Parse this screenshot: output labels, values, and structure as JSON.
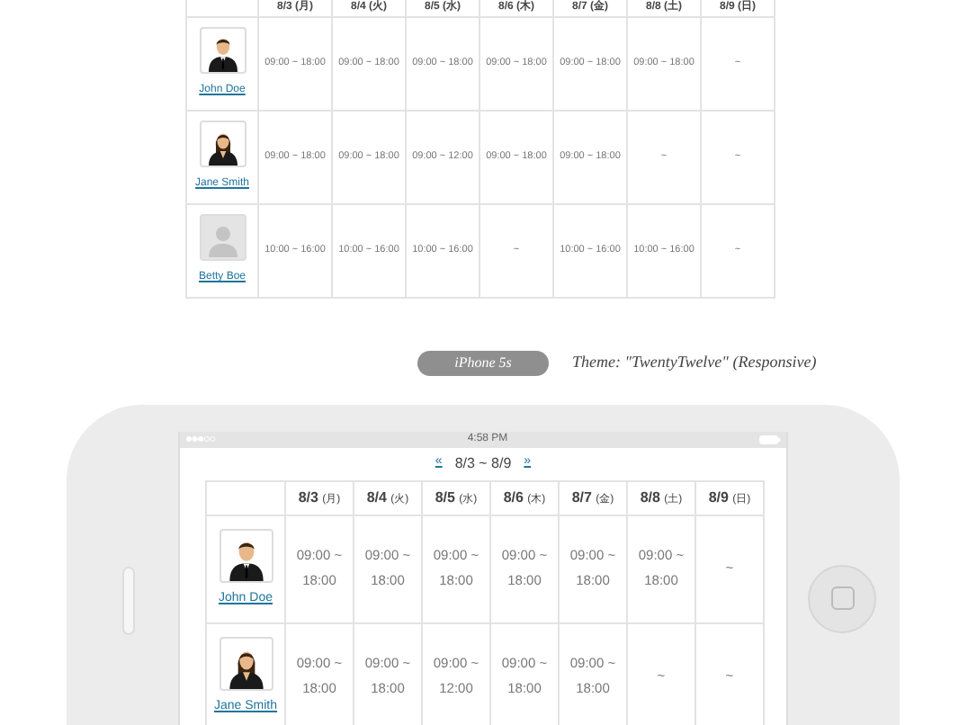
{
  "desktop_table": {
    "columns": [
      "8/3 (月)",
      "8/4 (火)",
      "8/5 (水)",
      "8/6 (木)",
      "8/7 (金)",
      "8/8 (土)",
      "8/9 (日)"
    ],
    "rows": [
      {
        "name": "John Doe",
        "kind": "male",
        "cells": [
          "09:00 ~ 18:00",
          "09:00 ~ 18:00",
          "09:00 ~ 18:00",
          "09:00 ~ 18:00",
          "09:00 ~ 18:00",
          "09:00 ~ 18:00",
          "~"
        ]
      },
      {
        "name": "Jane Smith",
        "kind": "female",
        "cells": [
          "09:00 ~ 18:00",
          "09:00 ~ 18:00",
          "09:00 ~ 12:00",
          "09:00 ~ 18:00",
          "09:00 ~ 18:00",
          "~",
          "~"
        ]
      },
      {
        "name": "Betty Boe",
        "kind": "placeholder",
        "cells": [
          "10:00 ~ 16:00",
          "10:00 ~ 16:00",
          "10:00 ~ 16:00",
          "~",
          "10:00 ~ 16:00",
          "10:00 ~ 16:00",
          "~"
        ]
      }
    ]
  },
  "device_label": {
    "device": "iPhone 5s",
    "theme": "Theme: \"TwentyTwelve\" (Responsive)"
  },
  "phone": {
    "status_bar": {
      "time": "4:58 PM"
    },
    "nav": {
      "prev": "«",
      "range": "8/3 ~ 8/9",
      "next": "»"
    },
    "table": {
      "columns": [
        {
          "date": "8/3",
          "day": "(月)"
        },
        {
          "date": "8/4",
          "day": "(火)"
        },
        {
          "date": "8/5",
          "day": "(水)"
        },
        {
          "date": "8/6",
          "day": "(木)"
        },
        {
          "date": "8/7",
          "day": "(金)"
        },
        {
          "date": "8/8",
          "day": "(土)"
        },
        {
          "date": "8/9",
          "day": "(日)"
        }
      ],
      "rows": [
        {
          "name": "John Doe",
          "kind": "male",
          "cells": [
            "09:00 ~ 18:00",
            "09:00 ~ 18:00",
            "09:00 ~ 18:00",
            "09:00 ~ 18:00",
            "09:00 ~ 18:00",
            "09:00 ~ 18:00",
            "~"
          ]
        },
        {
          "name": "Jane Smith",
          "kind": "female",
          "cells": [
            "09:00 ~ 18:00",
            "09:00 ~ 18:00",
            "09:00 ~ 12:00",
            "09:00 ~ 18:00",
            "09:00 ~ 18:00",
            "~",
            "~"
          ]
        }
      ]
    }
  }
}
